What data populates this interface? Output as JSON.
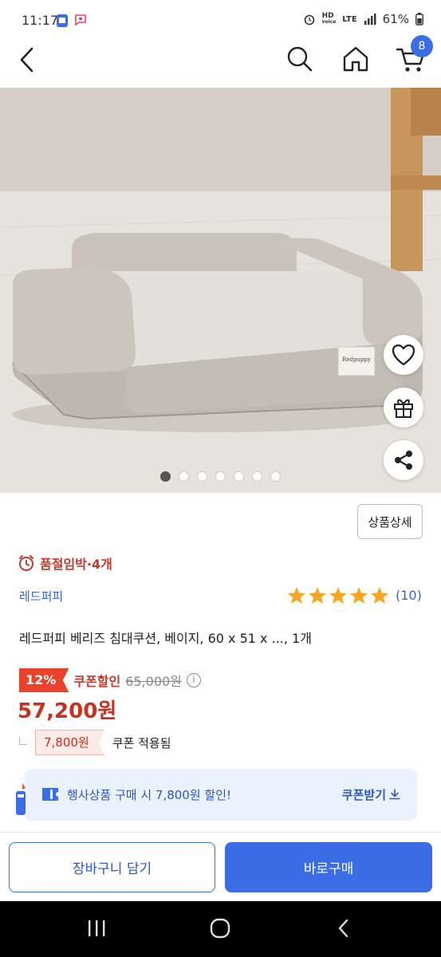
{
  "status_bar": {
    "time": "11:17",
    "network_hd": "HD",
    "network_voice": "voice",
    "network_lte": "LTE",
    "battery": "61%"
  },
  "nav": {
    "cart_count": "8"
  },
  "product_image": {
    "dot_count": 7,
    "active_dot": 0,
    "brand_tag": "Redpuppy"
  },
  "detail_button": "상품상세",
  "stock_notice": "품절임박·4개",
  "brand": "레드퍼피",
  "rating": {
    "stars": 5,
    "review_count": "(10)"
  },
  "title": "레드퍼피 베리즈 침대쿠션, 베이지, 60 x 51 x ..., 1개",
  "price": {
    "discount": "12%",
    "coupon_label": "쿠폰할인",
    "original": "65,000원",
    "sale": "57,200원",
    "coupon_amount": "7,800원",
    "coupon_applied": "쿠폰 적용됨"
  },
  "promo": {
    "text": "행사상품 구매 시 7,800원 할인!",
    "link": "쿠폰받기"
  },
  "actions": {
    "cart": "장바구니 담기",
    "buy": "바로구매"
  },
  "colors": {
    "accent_blue": "#3b6ee6",
    "sale_red": "#c8311f",
    "star": "#f5a623"
  }
}
